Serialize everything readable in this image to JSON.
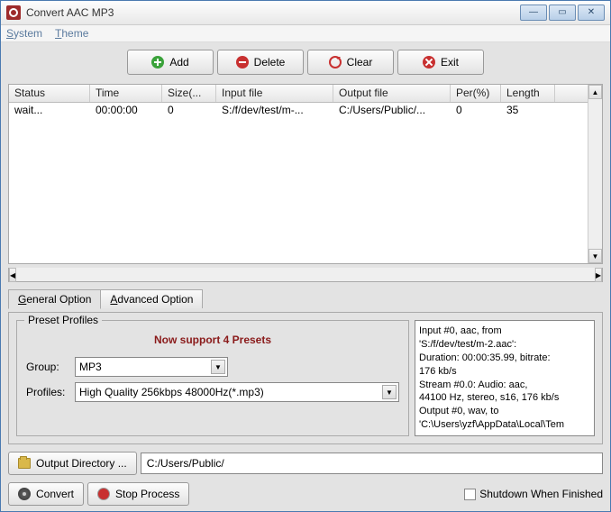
{
  "window": {
    "title": "Convert AAC MP3"
  },
  "menu": {
    "system": "System",
    "theme": "Theme"
  },
  "toolbar": {
    "add": "Add",
    "delete": "Delete",
    "clear": "Clear",
    "exit": "Exit"
  },
  "table": {
    "headers": {
      "status": "Status",
      "time": "Time",
      "size": "Size(...",
      "input": "Input file",
      "output": "Output file",
      "per": "Per(%)",
      "length": "Length"
    },
    "rows": [
      {
        "status": "wait...",
        "time": "00:00:00",
        "size": "0",
        "input": "S:/f/dev/test/m-...",
        "output": "C:/Users/Public/...",
        "per": "0",
        "length": "35"
      }
    ]
  },
  "tabs": {
    "general": "General Option",
    "advanced": "Advanced Option"
  },
  "preset": {
    "legend": "Preset Profiles",
    "message": "Now support 4 Presets",
    "group_label": "Group:",
    "group_value": "MP3",
    "profiles_label": "Profiles:",
    "profiles_value": "High Quality 256kbps 48000Hz(*.mp3)"
  },
  "info": {
    "line1": "Input #0, aac, from",
    "line2": "'S:/f/dev/test/m-2.aac':",
    "line3": "  Duration: 00:00:35.99, bitrate:",
    "line4": "176 kb/s",
    "line5": "    Stream #0.0: Audio: aac,",
    "line6": "44100 Hz, stereo, s16, 176 kb/s",
    "line7": "Output #0, wav, to",
    "line8": "'C:\\Users\\yzf\\AppData\\Local\\Tem"
  },
  "output": {
    "dir_button": "Output Directory ...",
    "path": "C:/Users/Public/"
  },
  "actions": {
    "convert": "Convert",
    "stop": "Stop Process",
    "shutdown": "Shutdown When Finished"
  }
}
